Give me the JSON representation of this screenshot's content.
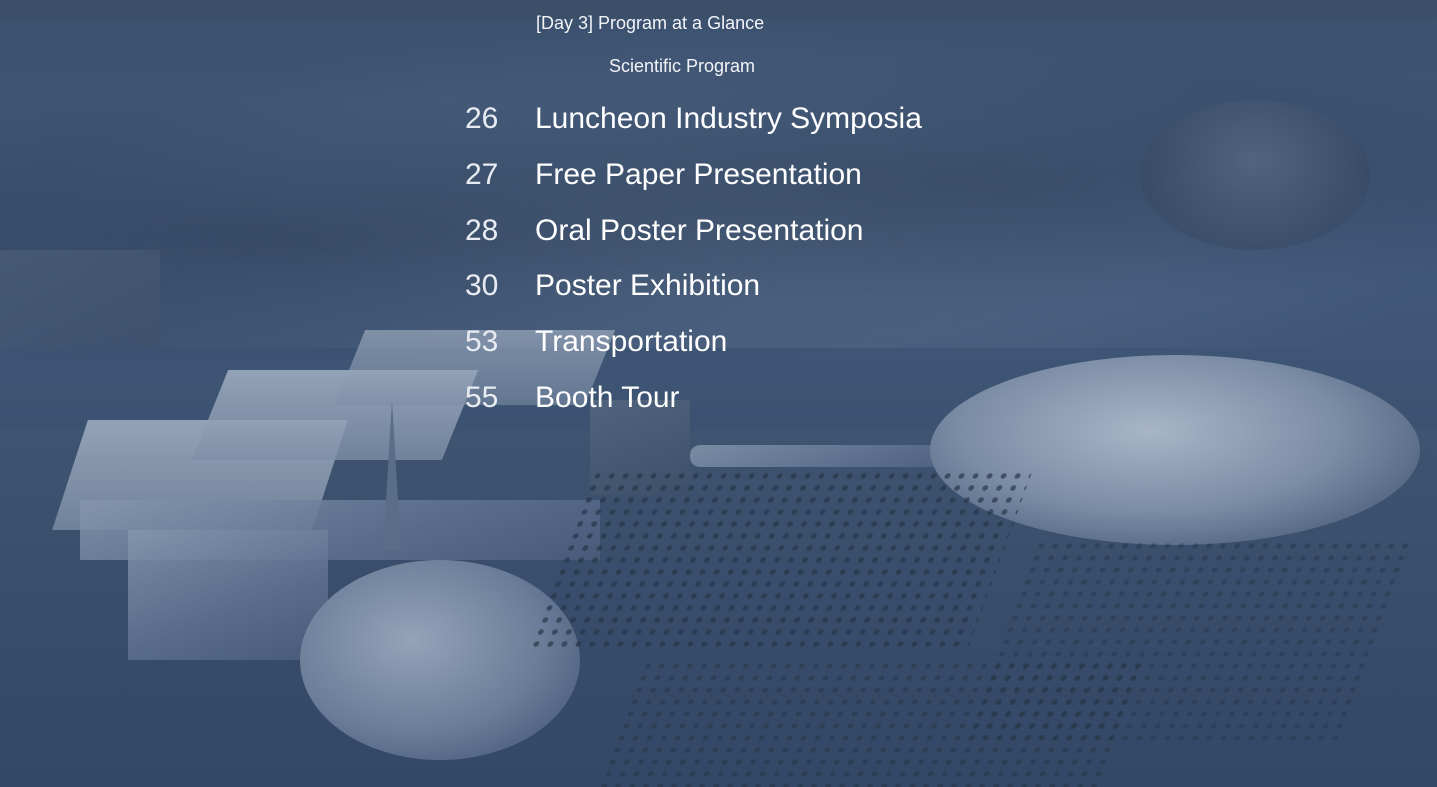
{
  "toc": {
    "sub_items": [
      "[Day 3] Program at a Glance",
      "Scientific Program"
    ],
    "entries": [
      {
        "page": "26",
        "title": "Luncheon Industry Symposia"
      },
      {
        "page": "27",
        "title": "Free Paper Presentation"
      },
      {
        "page": "28",
        "title": "Oral Poster Presentation"
      },
      {
        "page": "30",
        "title": "Poster Exhibition"
      },
      {
        "page": "53",
        "title": "Transportation"
      },
      {
        "page": "55",
        "title": "Booth Tour"
      }
    ]
  },
  "colors": {
    "overlay": "#3f5573",
    "text": "#ffffff"
  }
}
